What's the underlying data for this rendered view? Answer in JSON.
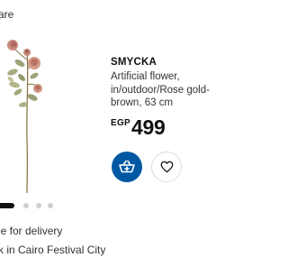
{
  "page": {
    "top_text": "are"
  },
  "product": {
    "name": "SMYCKA",
    "description_lines": [
      "Artificial flower,",
      "in/outdoor/Rose gold-",
      "brown, 63 cm"
    ],
    "price": {
      "currency": "EGP",
      "amount": "499"
    },
    "image": "artificial-rose-stem"
  },
  "actions": {
    "add_to_cart_icon": "cart-add-icon",
    "favourite_icon": "heart-icon",
    "primary_color": "#0058a3"
  },
  "carousel": {
    "total_slides": 5,
    "active_index": 0
  },
  "availability": {
    "delivery": "le for delivery",
    "store": "k in Cairo Festival City"
  }
}
